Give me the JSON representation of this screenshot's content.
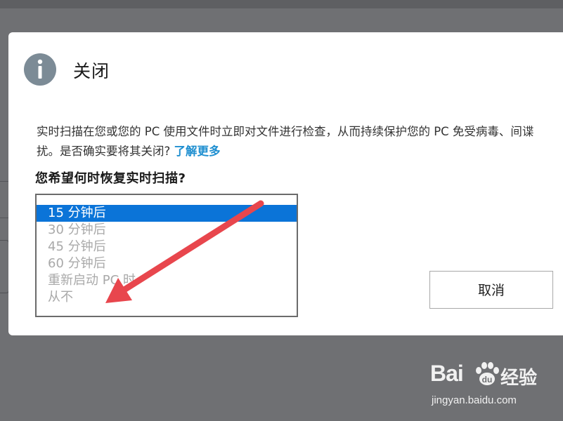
{
  "dialog": {
    "title": "关闭",
    "description_line1": "实时扫描在您或您的 PC 使用文件时立即对文件进行检查，从而持续保护您的 PC 免受病毒、间谍",
    "description_line2": "扰。是否确实要将其关闭? ",
    "learn_more": "了解更多",
    "question": "您希望何时恢复实时扫描?",
    "options": [
      "15 分钟后",
      "30 分钟后",
      "45 分钟后",
      "60 分钟后",
      "重新启动 PC 时",
      "从不"
    ],
    "selected_index": 0,
    "cancel_label": "取消"
  },
  "watermark": {
    "logo_text": "Bai",
    "logo_cn": "经验",
    "url": "jingyan.baidu.com"
  },
  "colors": {
    "selected_bg": "#0b74d8",
    "link": "#1f8fd0",
    "annotation_arrow": "#e8464d",
    "backdrop": "#6f7073"
  },
  "icons": {
    "dialog_icon": "info-icon",
    "annotation": "arrow-annotation-icon"
  }
}
